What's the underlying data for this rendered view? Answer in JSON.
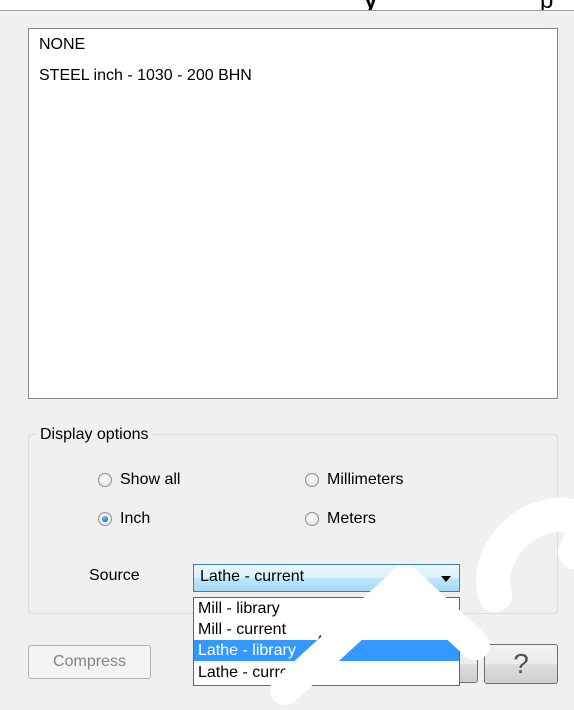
{
  "header": {
    "cut_text": "y",
    "cut_text2": "p"
  },
  "materials_list": {
    "items": [
      "NONE",
      "STEEL inch - 1030 - 200 BHN"
    ]
  },
  "display_options": {
    "label": "Display options",
    "show_all": "Show all",
    "inch": "Inch",
    "millimeters": "Millimeters",
    "meters": "Meters",
    "selected": "Inch"
  },
  "source": {
    "label": "Source",
    "value": "Lathe - current",
    "options": [
      "Mill - library",
      "Mill - current",
      "Lathe - library",
      "Lathe - current"
    ],
    "highlighted": "Lathe - library"
  },
  "buttons": {
    "compress": "Compress",
    "help": "?"
  },
  "colors": {
    "highlight": "#3399ff",
    "watermark": "#ffffff"
  }
}
